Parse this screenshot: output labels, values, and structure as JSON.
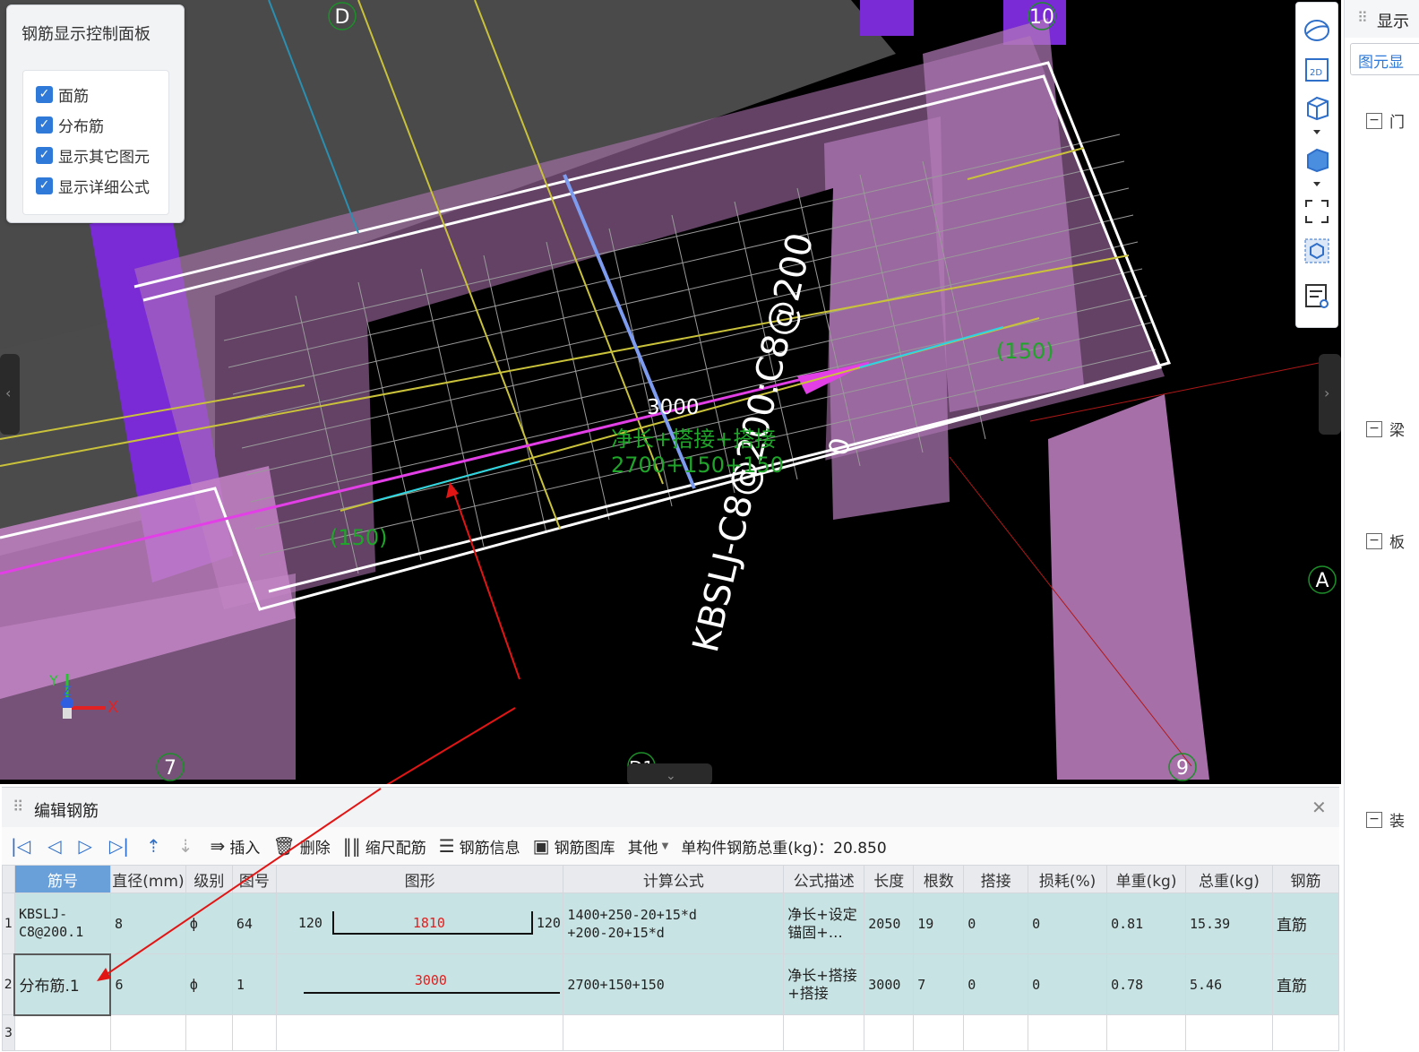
{
  "control_panel": {
    "title": "钢筋显示控制面板",
    "options": [
      {
        "label": "面筋",
        "checked": true
      },
      {
        "label": "分布筋",
        "checked": true
      },
      {
        "label": "显示其它图元",
        "checked": true
      },
      {
        "label": "显示详细公式",
        "checked": true
      }
    ]
  },
  "viewport": {
    "axis_labels": {
      "d": "D",
      "ten": "10",
      "a": "A",
      "seven": "7",
      "nine": "9",
      "d1": "D1"
    },
    "rebar_label": "KBSLJ-C8@200:C8@200",
    "dim_length": "3000",
    "formula_desc": "净长+搭接+搭接",
    "formula_value": "2700+150+150",
    "left_overlap": "(150)",
    "right_overlap": "(150)",
    "zero_mark": "0",
    "axis_x": "X",
    "axis_y": "Y",
    "axis_z": "Z"
  },
  "right_panel": {
    "header": "显示",
    "tab": "图元显",
    "groups": [
      {
        "label": "门"
      },
      {
        "label": "梁"
      },
      {
        "label": "板"
      },
      {
        "label": "装"
      }
    ]
  },
  "editor": {
    "title": "编辑钢筋",
    "toolbar": {
      "insert": "插入",
      "delete": "删除",
      "scale_rebar": "缩尺配筋",
      "rebar_info": "钢筋信息",
      "rebar_library": "钢筋图库",
      "other": "其他",
      "total_weight_label": "单构件钢筋总重(kg)：20.850"
    },
    "columns": [
      "筋号",
      "直径(mm)",
      "级别",
      "图号",
      "图形",
      "计算公式",
      "公式描述",
      "长度",
      "根数",
      "搭接",
      "损耗(%)",
      "单重(kg)",
      "总重(kg)",
      "钢筋"
    ],
    "rows": [
      {
        "index": "1",
        "name_line1": "KBSLJ-",
        "name_line2": "C8@200.1",
        "diameter": "8",
        "grade": "ф",
        "figure_no": "64",
        "shape_left": "120",
        "shape_mid": "1810",
        "shape_right": "120",
        "formula_line1": "1400+250-20+15*d",
        "formula_line2": "+200-20+15*d",
        "desc_line1": "净长+设定",
        "desc_line2": "锚固+…",
        "length": "2050",
        "count": "19",
        "lap": "0",
        "loss": "0",
        "unit_weight": "0.81",
        "total_weight": "15.39",
        "type": "直筋"
      },
      {
        "index": "2",
        "name_line1": "分布筋.1",
        "name_line2": "",
        "diameter": "6",
        "grade": "ф",
        "figure_no": "1",
        "shape_left": "",
        "shape_mid": "3000",
        "shape_right": "",
        "formula_line1": "2700+150+150",
        "formula_line2": "",
        "desc_line1": "净长+搭接",
        "desc_line2": "+搭接",
        "length": "3000",
        "count": "7",
        "lap": "0",
        "loss": "0",
        "unit_weight": "0.78",
        "total_weight": "5.46",
        "type": "直筋"
      },
      {
        "index": "3"
      }
    ]
  },
  "colors": {
    "accent": "#2f7ad8",
    "row_highlight": "#c8e3e3",
    "pink": "#b479b8",
    "purple": "#7a2bd6",
    "grid_yellow": "#c9c23a"
  }
}
